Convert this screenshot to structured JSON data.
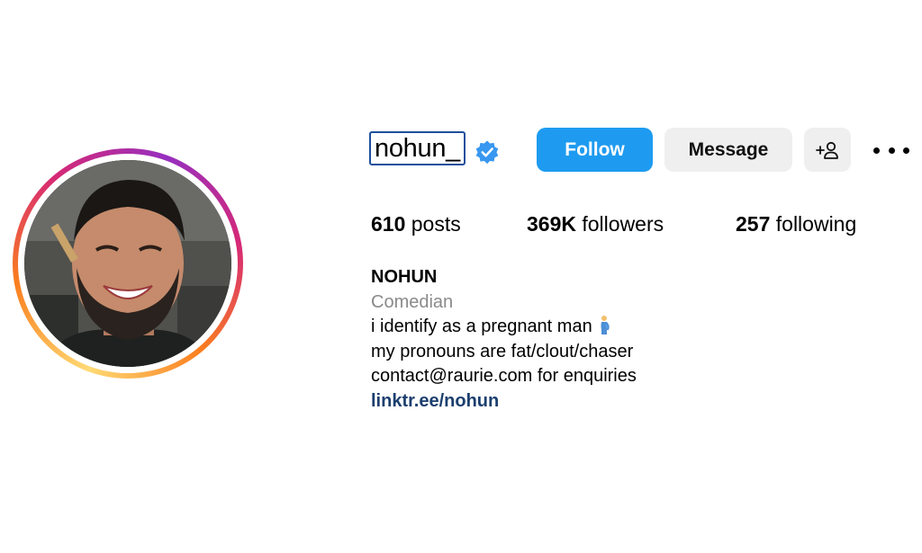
{
  "profile": {
    "username": "nohun_",
    "verified": true
  },
  "actions": {
    "follow_label": "Follow",
    "message_label": "Message",
    "suggest_icon": "add-person-icon",
    "more_icon": "more-options-icon"
  },
  "stats": {
    "posts_count": "610",
    "posts_label": " posts",
    "followers_count": "369K",
    "followers_label": " followers",
    "following_count": "257",
    "following_label": " following"
  },
  "bio": {
    "name": "NOHUN",
    "category": "Comedian",
    "line1": "i identify as a pregnant man",
    "line1_emoji": "pregnant-man-emoji",
    "line2": "my pronouns are fat/clout/chaser",
    "line3": "contact@raurie.com for enquiries",
    "link": "linktr.ee/nohun"
  },
  "colors": {
    "follow_button": "#1e9bf0",
    "secondary_button": "#efefef",
    "verified_badge": "#3897f0",
    "link": "#1b3f6e",
    "category": "#8a8a8a"
  }
}
